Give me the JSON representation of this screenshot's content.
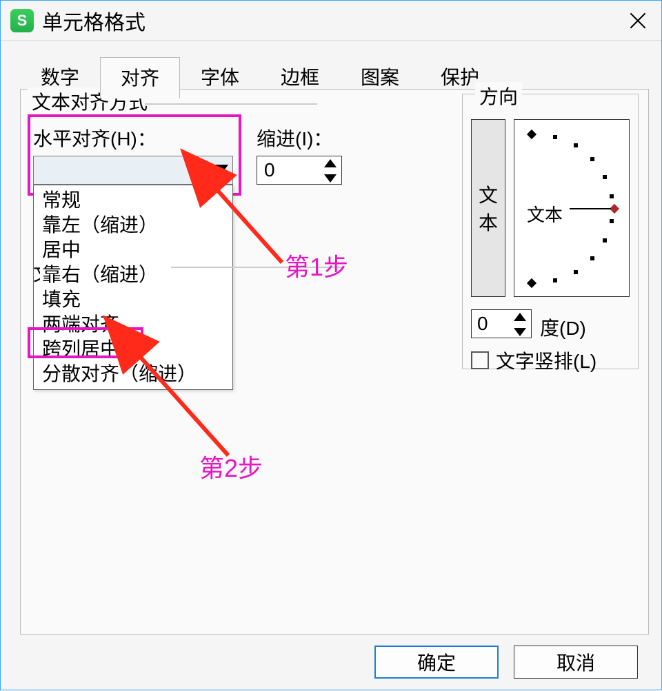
{
  "window": {
    "title": "单元格格式"
  },
  "tabs": {
    "items": [
      {
        "label": "数字"
      },
      {
        "label": "对齐"
      },
      {
        "label": "字体"
      },
      {
        "label": "边框"
      },
      {
        "label": "图案"
      },
      {
        "label": "保护"
      }
    ],
    "active": 1
  },
  "align": {
    "group_label": "文本对齐方式",
    "h_label": "水平对齐(H)：",
    "h_value": "",
    "indent_label": "缩进(I)：",
    "indent_value": "0",
    "options": [
      "常规",
      "靠左（缩进）",
      "居中",
      "靠右（缩进）",
      "填充",
      "两端对齐",
      "跨列居中",
      "分散对齐（缩进）"
    ],
    "text_control_hint": "文"
  },
  "orientation": {
    "label": "方向",
    "vbox_char1": "文",
    "vbox_char2": "本",
    "dial_text": "文本",
    "degree_value": "0",
    "degree_label": "度(D)",
    "vertical_label": "文字竖排(L)"
  },
  "buttons": {
    "ok": "确定",
    "cancel": "取消"
  },
  "annotations": {
    "step1": "第1步",
    "step2": "第2步"
  }
}
